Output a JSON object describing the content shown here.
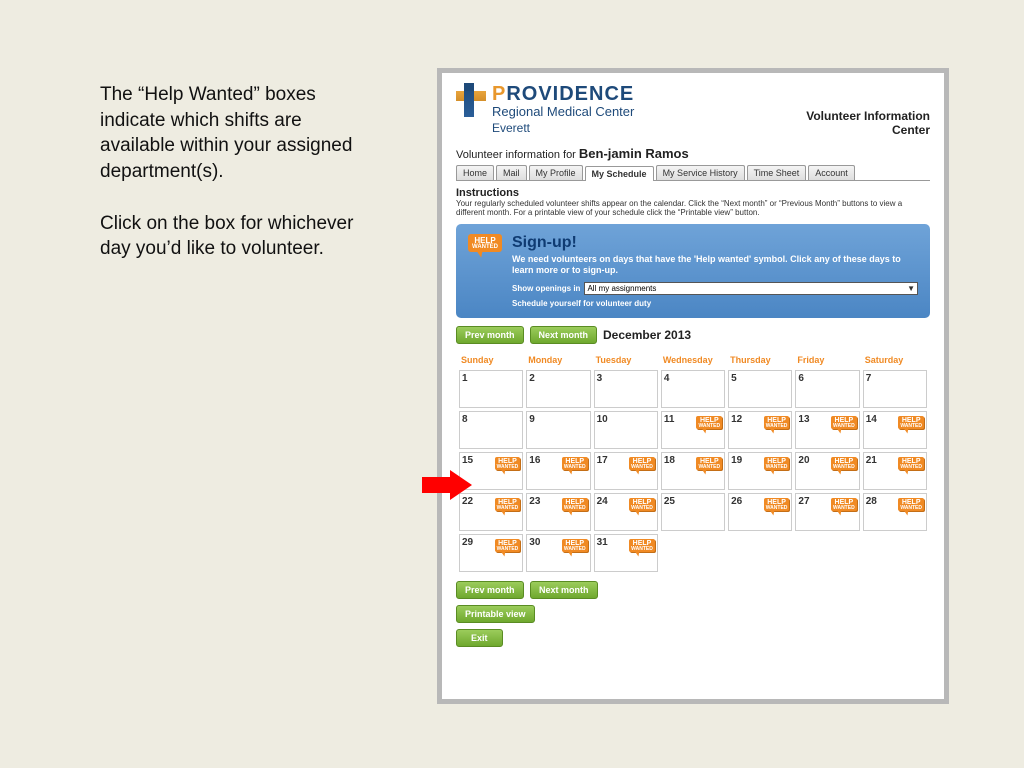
{
  "slide": {
    "p1": "The “Help Wanted” boxes indicate which shifts are available within your assigned department(s).",
    "p2": "Click on the box for whichever day you’d like to volunteer."
  },
  "logo": {
    "word1": "PROVIDENCE",
    "line2": "Regional Medical Center",
    "line3": "Everett"
  },
  "vic_title_l1": "Volunteer Information",
  "vic_title_l2": "Center",
  "vol_info_prefix": "Volunteer information for",
  "vol_name": "Ben-jamin Ramos",
  "tabs": [
    {
      "label": "Home",
      "active": false
    },
    {
      "label": "Mail",
      "active": false
    },
    {
      "label": "My Profile",
      "active": false
    },
    {
      "label": "My Schedule",
      "active": true
    },
    {
      "label": "My Service History",
      "active": false
    },
    {
      "label": "Time Sheet",
      "active": false
    },
    {
      "label": "Account",
      "active": false
    }
  ],
  "instructions_h": "Instructions",
  "instructions_p": "Your regularly scheduled volunteer shifts appear on the calendar. Click the “Next month” or “Previous Month” buttons to view a different month. For a printable view of your schedule click the “Printable view” button.",
  "hw_l1": "HELP",
  "hw_l2": "WANTED",
  "signup_title": "Sign-up!",
  "signup_sub": "We need volunteers on days that have the 'Help wanted' symbol. Click any of these days to learn more or to sign-up.",
  "show_openings_label": "Show openings in",
  "show_openings_value": "All my assignments",
  "sched_link": "Schedule yourself for volunteer duty",
  "prev_btn": "Prev month",
  "next_btn": "Next month",
  "month_label": "December 2013",
  "printable_btn": "Printable view",
  "exit_btn": "Exit",
  "day_headers": [
    "Sunday",
    "Monday",
    "Tuesday",
    "Wednesday",
    "Thursday",
    "Friday",
    "Saturday"
  ],
  "calendar": [
    [
      {
        "n": 1
      },
      {
        "n": 2
      },
      {
        "n": 3
      },
      {
        "n": 4
      },
      {
        "n": 5
      },
      {
        "n": 6
      },
      {
        "n": 7
      }
    ],
    [
      {
        "n": 8
      },
      {
        "n": 9
      },
      {
        "n": 10
      },
      {
        "n": 11,
        "hw": true
      },
      {
        "n": 12,
        "hw": true
      },
      {
        "n": 13,
        "hw": true
      },
      {
        "n": 14,
        "hw": true
      }
    ],
    [
      {
        "n": 15,
        "hw": true
      },
      {
        "n": 16,
        "hw": true
      },
      {
        "n": 17,
        "hw": true
      },
      {
        "n": 18,
        "hw": true
      },
      {
        "n": 19,
        "hw": true
      },
      {
        "n": 20,
        "hw": true
      },
      {
        "n": 21,
        "hw": true
      }
    ],
    [
      {
        "n": 22,
        "hw": true
      },
      {
        "n": 23,
        "hw": true
      },
      {
        "n": 24,
        "hw": true
      },
      {
        "n": 25
      },
      {
        "n": 26,
        "hw": true
      },
      {
        "n": 27,
        "hw": true
      },
      {
        "n": 28,
        "hw": true
      }
    ],
    [
      {
        "n": 29,
        "hw": true
      },
      {
        "n": 30,
        "hw": true
      },
      {
        "n": 31,
        "hw": true
      },
      {
        "empty": true
      },
      {
        "empty": true
      },
      {
        "empty": true
      },
      {
        "empty": true
      }
    ]
  ]
}
